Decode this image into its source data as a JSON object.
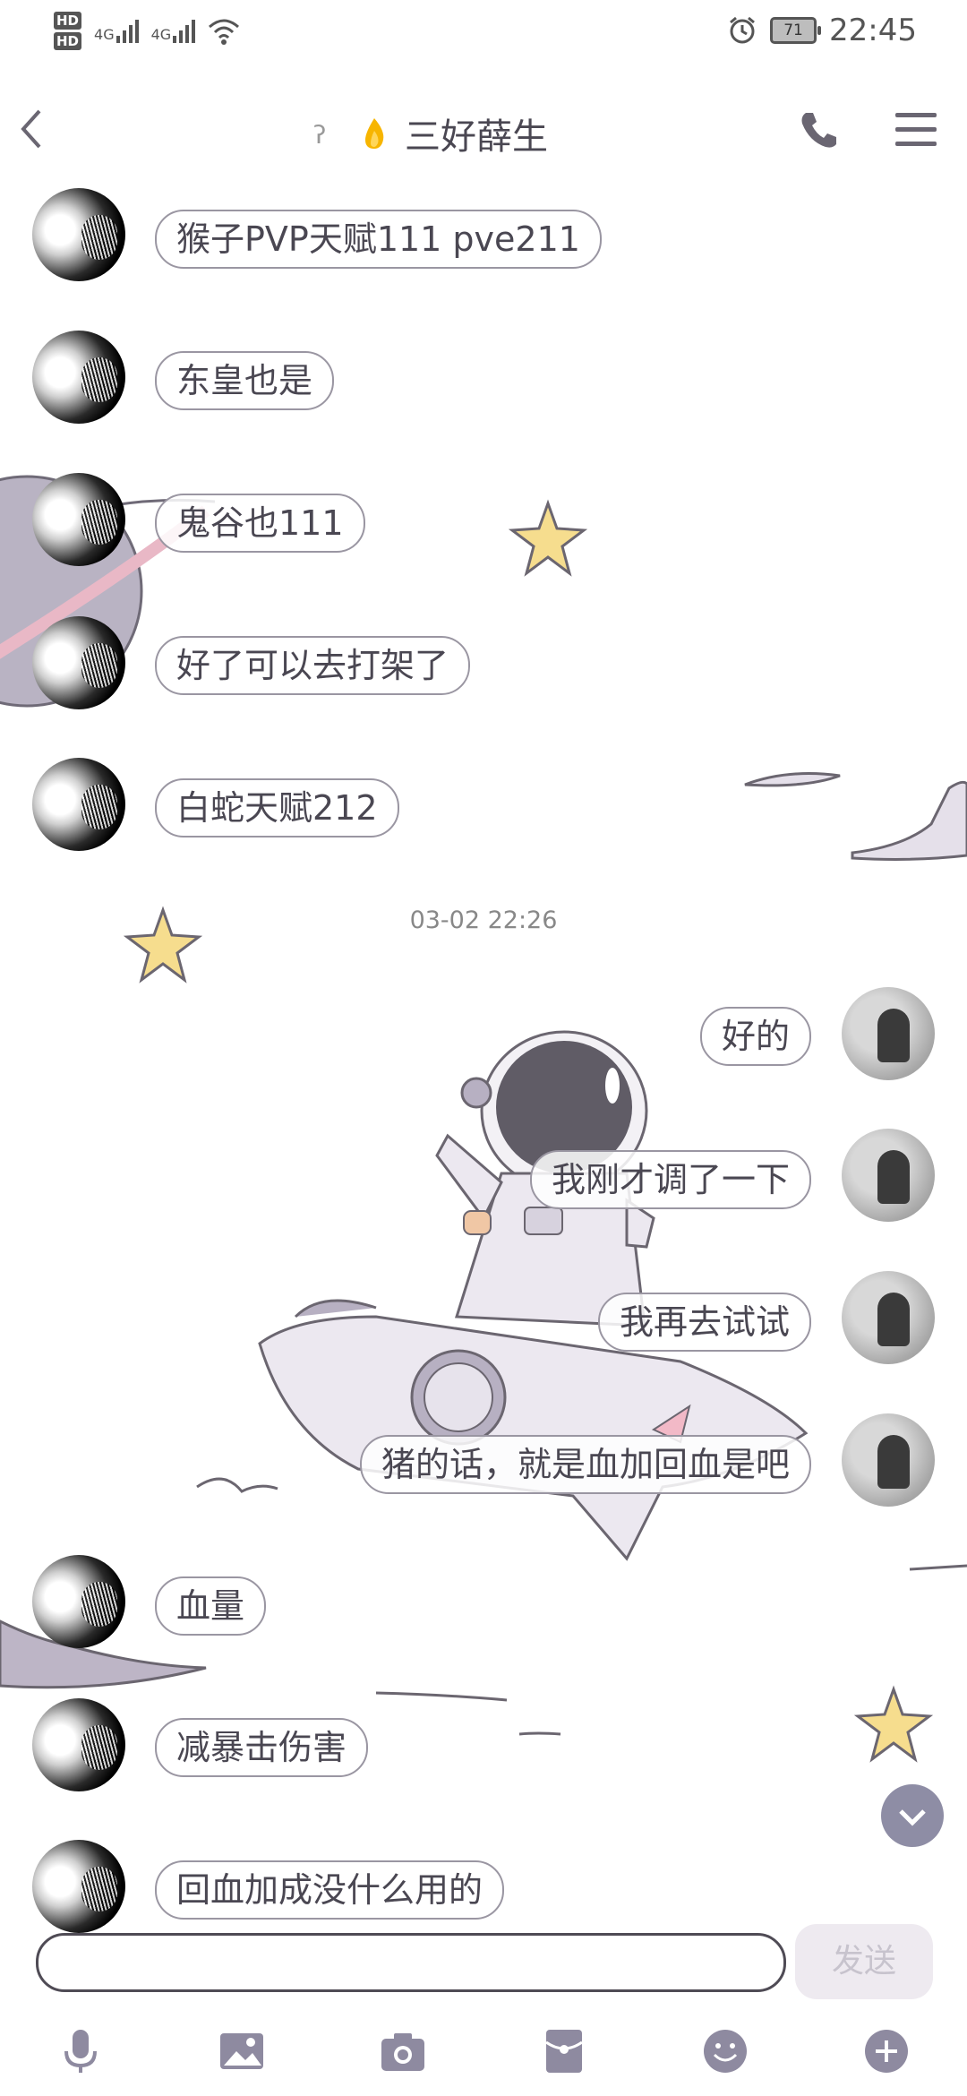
{
  "status_bar": {
    "hd1": "HD",
    "hd2": "HD",
    "net1": "4G",
    "net2": "4G",
    "battery": "71",
    "time": "22:45"
  },
  "header": {
    "title": "三好薛生"
  },
  "messages_top": [
    {
      "text": "猴子PVP天赋111  pve211"
    },
    {
      "text": "东皇也是"
    },
    {
      "text": "鬼谷也111"
    },
    {
      "text": "好了可以去打架了"
    },
    {
      "text": "白蛇天赋212"
    }
  ],
  "timestamp": "03-02 22:26",
  "messages_out": [
    {
      "text": "好的"
    },
    {
      "text": "我刚才调了一下"
    },
    {
      "text": "我再去试试"
    },
    {
      "text": "猪的话，就是血加回血是吧"
    }
  ],
  "messages_bottom": [
    {
      "text": "血量"
    },
    {
      "text": "减暴击伤害"
    },
    {
      "text": "回血加成没什么用的"
    }
  ],
  "composer": {
    "send_label": "发送"
  },
  "toolbar_icons": [
    "mic-icon",
    "image-icon",
    "camera-icon",
    "red-packet-icon",
    "emoji-icon",
    "plus-icon"
  ],
  "colors": {
    "accent": "#8e8da5",
    "bubble_border": "#9a96a2",
    "text": "#4a4752"
  }
}
